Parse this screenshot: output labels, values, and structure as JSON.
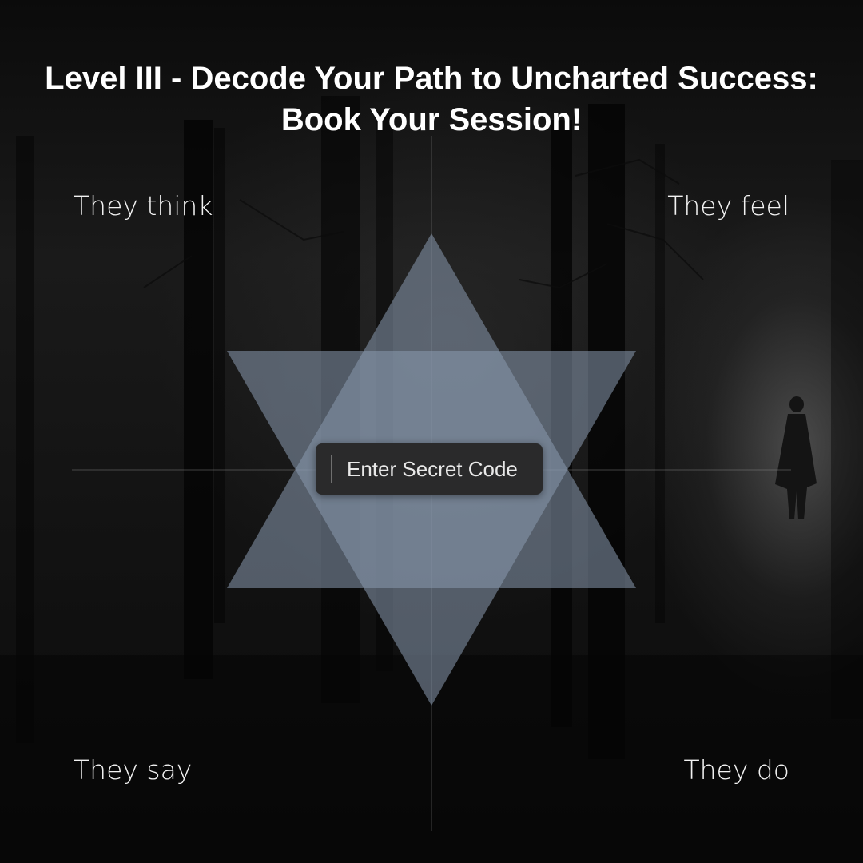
{
  "title": {
    "line1": "Level III - Decode Your Path to Uncharted Success:",
    "line2": "Book Your Session!"
  },
  "quadrants": {
    "top_left": "They think",
    "top_right": "They feel",
    "bottom_left": "They say",
    "bottom_right": "They do"
  },
  "secret_code": {
    "value": "",
    "placeholder": "Enter Secret Code"
  },
  "colors": {
    "star_fill": "#8a9bb0",
    "text": "#ffffff",
    "input_bg": "#2a2a2b"
  },
  "icons": {
    "center_emblem": "hexagram-icon",
    "figure": "standing-person-silhouette"
  }
}
